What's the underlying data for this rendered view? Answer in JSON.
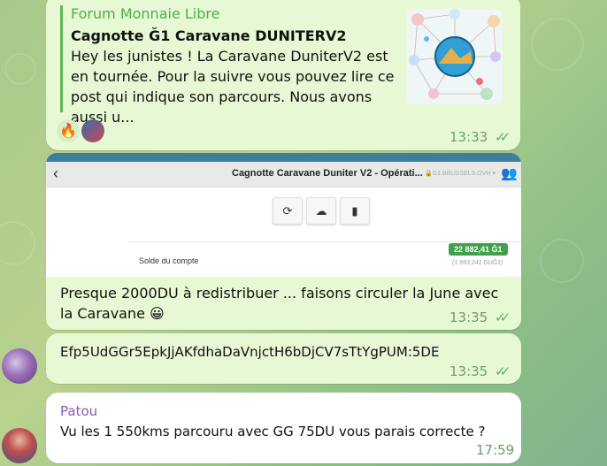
{
  "colors": {
    "outgoing_bubble": "#e7f8d4",
    "incoming_bubble": "#ffffff",
    "link_accent": "#4caf50",
    "sender_name": "#8a56b8",
    "ticks": "#5fae5f"
  },
  "messages": [
    {
      "type": "link_preview",
      "preview": {
        "site": "Forum Monnaie Libre",
        "title": "Cagnotte Ğ1 Caravane DUNITERV2",
        "description": "Hey les junistes !  La Caravane DuniterV2 est en tournée.  Pour la suivre vous pouvez lire ce post qui indique son parcours.  Nous avons aussi u..."
      },
      "reactions": [
        {
          "icon": "fire-emoji",
          "glyph": "🔥"
        },
        {
          "icon": "user-avatar"
        }
      ],
      "time": "13:33",
      "status_icon": "double-check-icon"
    },
    {
      "type": "photo_with_caption",
      "screenshot": {
        "title": "Cagnotte Caravane Duniter V2 - Opérati...",
        "domain": "🔒G1.BRUSSELS.OVH ▾",
        "buttons": [
          {
            "icon": "refresh-icon",
            "glyph": "⟳"
          },
          {
            "icon": "cloud-download-icon",
            "glyph": "☁"
          },
          {
            "icon": "bar-chart-icon",
            "glyph": "▮"
          }
        ],
        "balance_label": "Solde du compte",
        "balance_amount": "22 882,41 Ğ1",
        "balance_du": "(1 993,241 DUĞ1)"
      },
      "caption": "Presque 2000DU à redistribuer ... faisons circuler la June avec la Caravane 😀",
      "time": "13:35",
      "status_icon": "double-check-icon"
    },
    {
      "type": "text",
      "text": "Efp5UdGGr5EpkJjAKfdhaDaVnjctH6bDjCV7sTtYgPUM:5DE",
      "time": "13:35",
      "status_icon": "double-check-icon"
    },
    {
      "type": "incoming_text",
      "sender": "Patou",
      "text": "Vu les 1 550kms parcouru avec GG 75DU vous parais correcte ?",
      "time": "17:59"
    }
  ]
}
